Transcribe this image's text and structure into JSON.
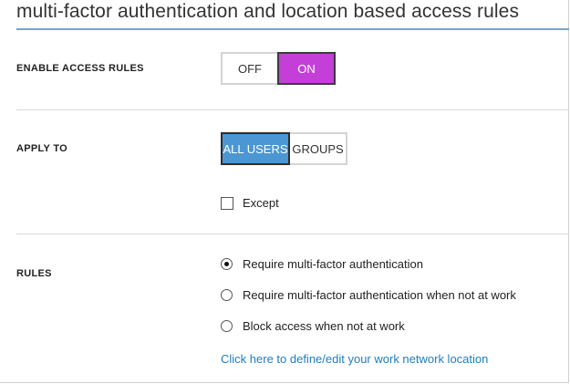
{
  "header": {
    "title": "multi-factor authentication and location based access rules"
  },
  "enable_access_rules": {
    "label": "ENABLE ACCESS RULES",
    "off_label": "OFF",
    "on_label": "ON",
    "selected": "ON"
  },
  "apply_to": {
    "label": "APPLY TO",
    "all_users_label": "ALL USERS",
    "groups_label": "GROUPS",
    "selected": "ALL USERS",
    "except_label": "Except",
    "except_checked": false
  },
  "rules": {
    "label": "RULES",
    "options": [
      {
        "label": "Require multi-factor authentication",
        "checked": true
      },
      {
        "label": "Require multi-factor authentication when not at work",
        "checked": false
      },
      {
        "label": "Block access when not at work",
        "checked": false
      }
    ],
    "link_text": "Click here to define/edit your work network location"
  },
  "colors": {
    "on_accent": "#c43fd8",
    "selected_accent": "#4a97d4",
    "link": "#1f7fc1",
    "title_rule": "#7aa4c8"
  }
}
